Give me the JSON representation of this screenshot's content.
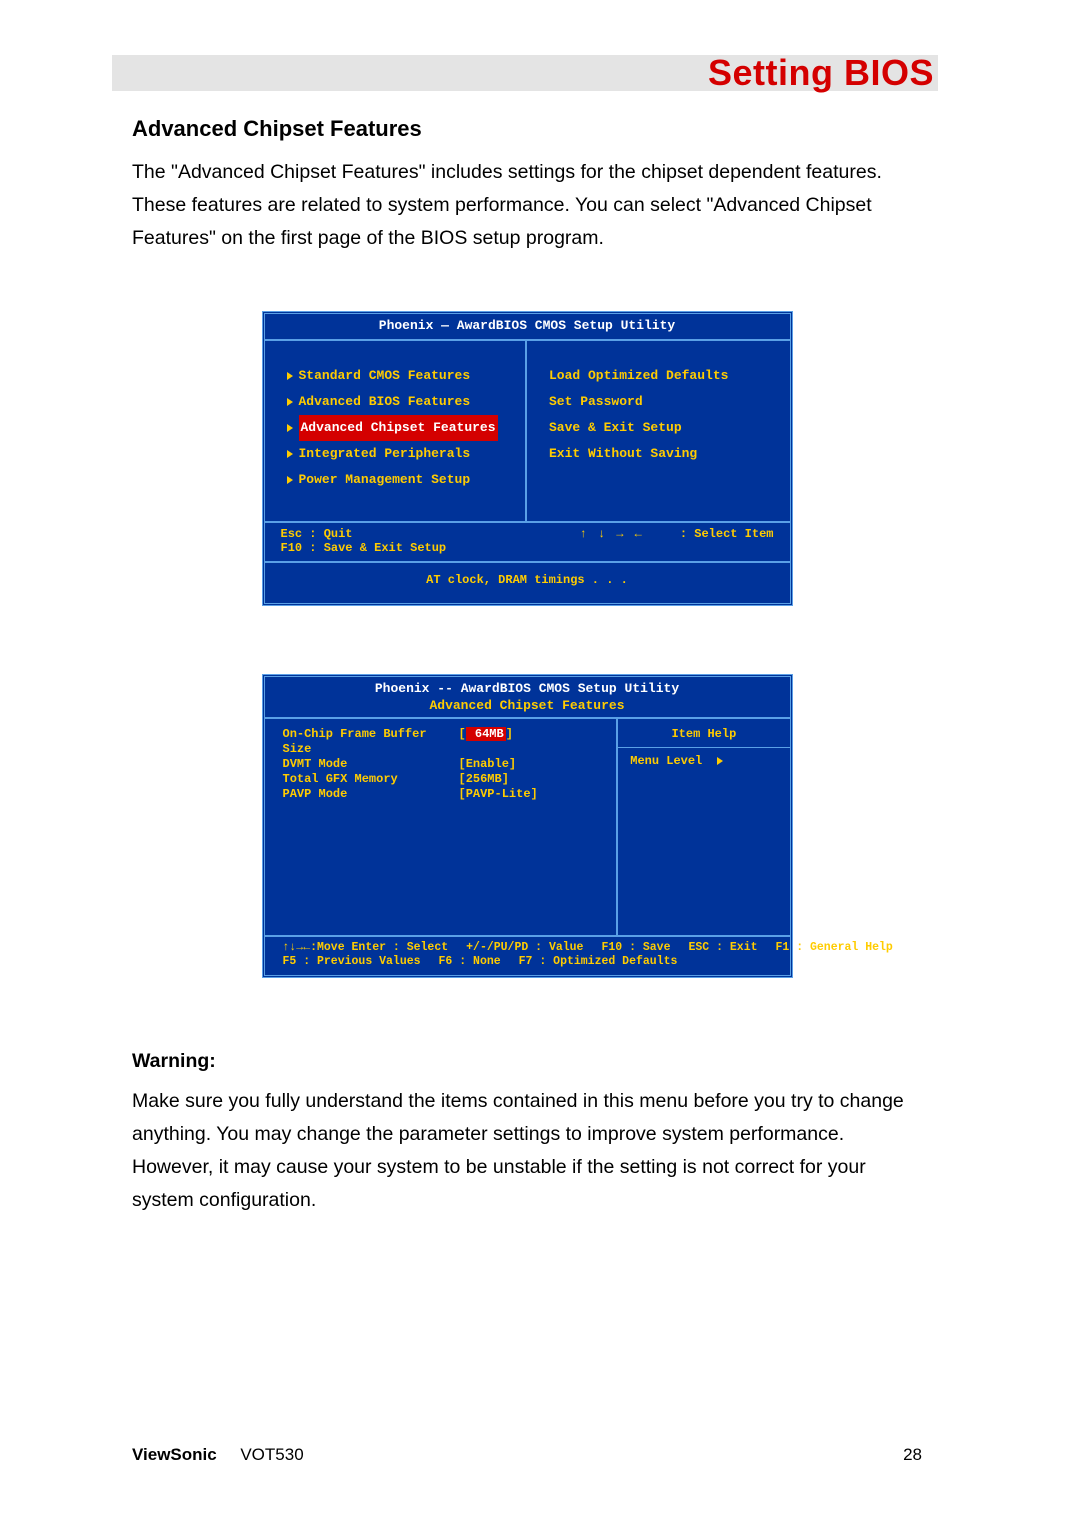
{
  "header": {
    "title": "Setting BIOS"
  },
  "section": {
    "heading": "Advanced Chipset Features",
    "intro": "The \"Advanced Chipset Features\" includes settings for the chipset dependent features. These features are related to system performance. You can select \"Advanced Chipset Features\" on the first page of the BIOS setup program."
  },
  "bios1": {
    "title": "Phoenix — AwardBIOS CMOS Setup Utility",
    "left": [
      "Standard CMOS Features",
      "Advanced BIOS Features",
      "Advanced Chipset Features",
      "Integrated Peripherals",
      "Power Management Setup"
    ],
    "right": [
      "Load Optimized Defaults",
      "Set Password",
      "Save & Exit Setup",
      "Exit Without Saving"
    ],
    "footer1_left_l1": "Esc : Quit",
    "footer1_left_l2": "F10 : Save & Exit Setup",
    "footer1_arrows": "↑ ↓ → ←",
    "footer1_right": ": Select Item",
    "footer2": "AT clock, DRAM timings . . ."
  },
  "bios2": {
    "title": "Phoenix -- AwardBIOS CMOS Setup Utility",
    "subtitle": "Advanced Chipset Features",
    "rows": [
      {
        "lbl": "On-Chip Frame Buffer Size",
        "b_open": "[",
        "val": "  64MB",
        "b_close": "]",
        "hl": true
      },
      {
        "lbl": "DVMT Mode",
        "b_open": "[",
        "val": "Enable",
        "b_close": "]",
        "hl": false
      },
      {
        "lbl": "Total GFX Memory",
        "b_open": "[",
        "val": "256MB",
        "b_close": "]",
        "hl": false
      },
      {
        "lbl": "PAVP Mode",
        "b_open": "[",
        "val": "PAVP-Lite",
        "b_close": "]",
        "hl": false
      }
    ],
    "side_title": "Item Help",
    "side_item": "Menu Level",
    "footer_l1_a": "↑↓→←:Move Enter : Select",
    "footer_l1_b": "+/-/PU/PD : Value",
    "footer_l1_c": "F10 : Save",
    "footer_l1_d": "ESC : Exit",
    "footer_l1_e": "F1 : General Help",
    "footer_l2_a": "F5 : Previous Values",
    "footer_l2_b": "F6 : None",
    "footer_l2_c": "F7 : Optimized Defaults"
  },
  "warning": {
    "heading": "Warning:",
    "text": "Make sure you fully understand the items contained in this menu before you try to change anything. You may change the parameter settings to improve system performance. However, it may cause your system to be unstable if the setting is not correct for your system configuration."
  },
  "footer": {
    "brand": "ViewSonic",
    "model": "VOT530",
    "page": "28"
  }
}
